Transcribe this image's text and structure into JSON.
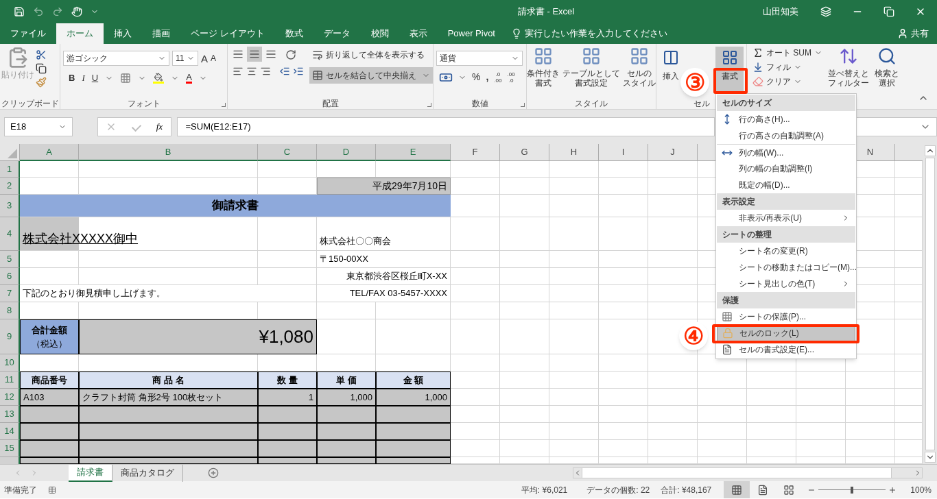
{
  "title_bar": {
    "title": "請求書 - Excel",
    "user": "山田知美"
  },
  "menu_tabs": [
    {
      "label": "ファイル",
      "selected": false
    },
    {
      "label": "ホーム",
      "selected": true
    },
    {
      "label": "挿入",
      "selected": false
    },
    {
      "label": "描画",
      "selected": false
    },
    {
      "label": "ページ レイアウト",
      "selected": false
    },
    {
      "label": "数式",
      "selected": false
    },
    {
      "label": "データ",
      "selected": false
    },
    {
      "label": "校閲",
      "selected": false
    },
    {
      "label": "表示",
      "selected": false
    },
    {
      "label": "Power Pivot",
      "selected": false
    }
  ],
  "tell_me": {
    "placeholder": "実行したい作業を入力してください"
  },
  "share": "共有",
  "ribbon": {
    "clipboard": {
      "label": "クリップボード",
      "paste": "貼り付け"
    },
    "font": {
      "label": "フォント",
      "font_name": "游ゴシック",
      "font_size": "11",
      "grow": "A",
      "shrink": "A",
      "bold": "B",
      "italic": "I",
      "underline": "U",
      "font_color": "A"
    },
    "alignment": {
      "label": "配置",
      "vertical": [
        {
          "selected": false
        },
        {
          "selected": true
        },
        {
          "selected": false
        }
      ],
      "wrap": {
        "label": "折り返して全体を表示する",
        "selected": false
      },
      "merge": {
        "label": "セルを結合して中央揃え",
        "selected": true
      }
    },
    "number": {
      "label": "数値",
      "format": "通貨",
      "percent": "%",
      "comma": ",",
      "increase_decimal": [
        ".0",
        ".00"
      ],
      "decrease_decimal": [
        ".00",
        ".0"
      ]
    },
    "styles": {
      "label": "スタイル",
      "buttons": [
        {
          "lines": [
            "条件付き",
            "書式"
          ]
        },
        {
          "lines": [
            "テーブルとして",
            "書式設定"
          ]
        },
        {
          "lines": [
            "セルの",
            "スタイル"
          ]
        }
      ]
    },
    "cells": {
      "label": "セル",
      "insert": "挿入",
      "format": {
        "label": "書式",
        "selected": true
      }
    },
    "editing": {
      "autosum": "オート SUM",
      "fill": "フィル",
      "clear": "クリア",
      "sort": [
        "並べ替えと",
        "フィルター"
      ],
      "find": [
        "検索と",
        "選択"
      ]
    }
  },
  "formula_bar": {
    "name_box": "E18",
    "fx": "fx",
    "formula": "=SUM(E12:E17)"
  },
  "sheet": {
    "columns": [
      {
        "label": "A",
        "selected": true
      },
      {
        "label": "B",
        "selected": true
      },
      {
        "label": "C",
        "selected": true
      },
      {
        "label": "D",
        "selected": true
      },
      {
        "label": "E",
        "selected": true
      },
      {
        "label": "F",
        "selected": false
      },
      {
        "label": "G",
        "selected": false
      },
      {
        "label": "H",
        "selected": false
      },
      {
        "label": "I",
        "selected": false
      },
      {
        "label": "J",
        "selected": false
      },
      {
        "label": "N",
        "selected": false
      }
    ],
    "rows": [
      {
        "label": "1",
        "selected": true
      },
      {
        "label": "2",
        "selected": true
      },
      {
        "label": "3",
        "selected": true
      },
      {
        "label": "4",
        "selected": true
      },
      {
        "label": "5",
        "selected": true
      },
      {
        "label": "6",
        "selected": true
      },
      {
        "label": "7",
        "selected": true
      },
      {
        "label": "8",
        "selected": true
      },
      {
        "label": "9",
        "selected": true
      },
      {
        "label": "10",
        "selected": true
      },
      {
        "label": "11",
        "selected": true
      },
      {
        "label": "12",
        "selected": true
      },
      {
        "label": "13",
        "selected": true
      },
      {
        "label": "14",
        "selected": true
      },
      {
        "label": "15",
        "selected": true
      }
    ],
    "invoice": {
      "date": "平成29年7月10日",
      "title": "御請求書",
      "recipient": "株式会社XXXXX御中",
      "sender": [
        "株式会社〇〇商会",
        "〒150-00XX",
        "東京都渋谷区桜丘町X-XX",
        "TEL/FAX 03-5457-XXXX"
      ],
      "greeting": "下記のとおり御見積申し上げます。",
      "total_label": "合計金額",
      "total_note": "（税込）",
      "total_amount": "¥1,080",
      "table": {
        "columns": [
          "商品番号",
          "商 品 名",
          "数 量",
          "単 価",
          "金 額"
        ],
        "rows": [
          [
            "A103",
            "クラフト封筒 角形2号 100枚セット",
            "1",
            "1,000",
            "1,000"
          ]
        ]
      }
    }
  },
  "format_menu": {
    "sections": [
      {
        "title": "セルのサイズ",
        "items": [
          {
            "label": "行の高さ(H)...",
            "submenu": false,
            "selected": false
          },
          {
            "label": "行の高さの自動調整(A)",
            "submenu": false,
            "selected": false
          },
          {
            "label": "列の幅(W)...",
            "submenu": false,
            "selected": false
          },
          {
            "label": "列の幅の自動調整(I)",
            "submenu": false,
            "selected": false
          },
          {
            "label": "既定の幅(D)...",
            "submenu": false,
            "selected": false
          }
        ]
      },
      {
        "title": "表示設定",
        "items": [
          {
            "label": "非表示/再表示(U)",
            "submenu": true,
            "selected": false
          }
        ]
      },
      {
        "title": "シートの整理",
        "items": [
          {
            "label": "シート名の変更(R)",
            "submenu": false,
            "selected": false
          },
          {
            "label": "シートの移動またはコピー(M)...",
            "submenu": false,
            "selected": false
          },
          {
            "label": "シート見出しの色(T)",
            "submenu": true,
            "selected": false
          }
        ]
      },
      {
        "title": "保護",
        "items": [
          {
            "label": "シートの保護(P)...",
            "submenu": false,
            "selected": false
          },
          {
            "label": "セルのロック(L)",
            "submenu": false,
            "selected": true
          },
          {
            "label": "セルの書式設定(E)...",
            "submenu": false,
            "selected": false
          }
        ]
      }
    ]
  },
  "annotations": [
    {
      "label": "③"
    },
    {
      "label": "④"
    }
  ],
  "sheet_tabs": [
    {
      "label": "請求書",
      "selected": true
    },
    {
      "label": "商品カタログ",
      "selected": false
    }
  ],
  "status_bar": {
    "status": "準備完了",
    "average": "平均: ¥6,021",
    "count": "データの個数: 22",
    "sum": "合計: ¥48,167",
    "views": [
      {
        "selected": true
      },
      {
        "selected": false
      },
      {
        "selected": false
      }
    ],
    "zoom": {
      "level": 0.5,
      "reading": "100%"
    }
  }
}
